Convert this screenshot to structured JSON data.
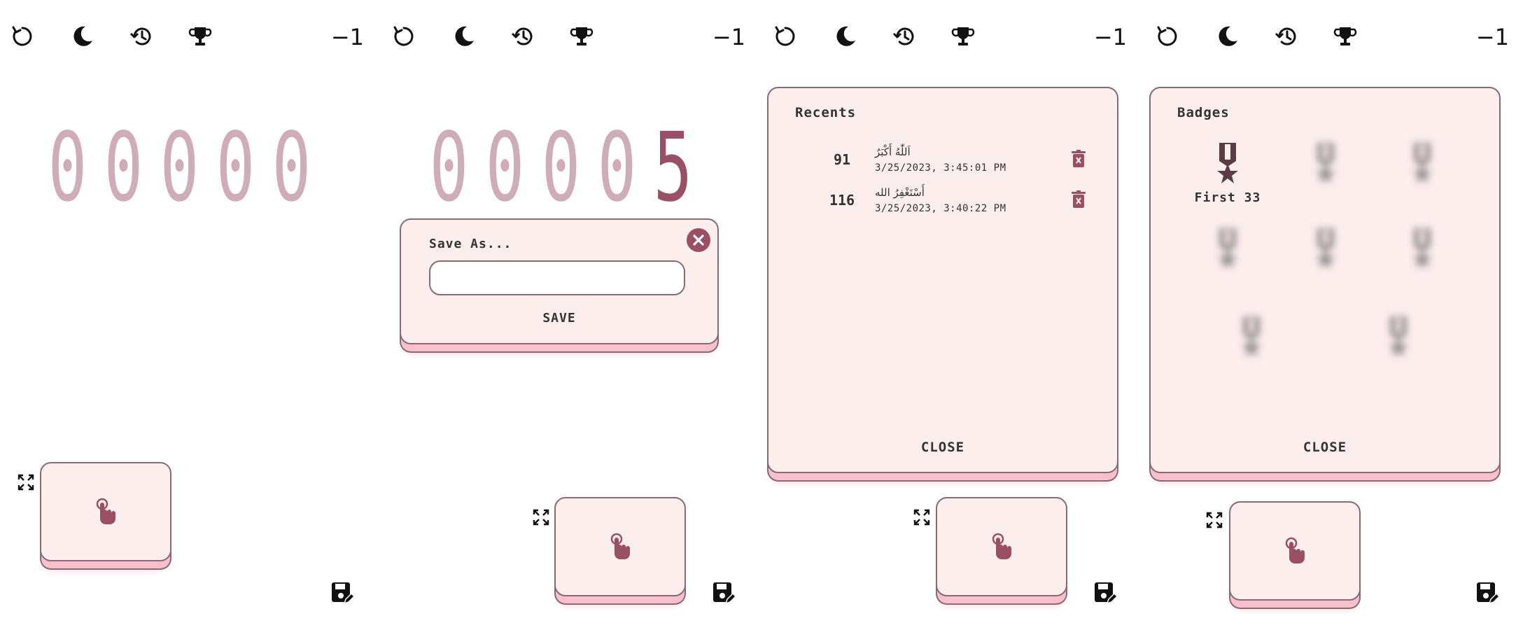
{
  "toolbar": {
    "step_value": "−1",
    "icons": [
      "reset-icon",
      "moon-icon",
      "history-icon",
      "trophy-icon"
    ]
  },
  "screen1": {
    "digits": [
      "0",
      "0",
      "0",
      "0",
      "0"
    ]
  },
  "screen2": {
    "digits": [
      "0",
      "0",
      "0",
      "0",
      "5"
    ],
    "dialog": {
      "title": "Save As...",
      "input_value": "",
      "save_label": "SAVE"
    }
  },
  "screen3": {
    "title": "Recents",
    "items": [
      {
        "count": "91",
        "text": "اَللّٰهُ أَكْبَرُ",
        "date": "3/25/2023, 3:45:01 PM"
      },
      {
        "count": "116",
        "text": "أَسْتَغْفِرُ الله",
        "date": "3/25/2023, 3:40:22 PM"
      }
    ],
    "close_label": "CLOSE"
  },
  "screen4": {
    "title": "Badges",
    "badges": [
      {
        "label": "First 33",
        "unlocked": true
      },
      {
        "label": "",
        "unlocked": false
      },
      {
        "label": "",
        "unlocked": false
      },
      {
        "label": "",
        "unlocked": false
      },
      {
        "label": "",
        "unlocked": false
      },
      {
        "label": "",
        "unlocked": false
      },
      {
        "label": "",
        "unlocked": false
      },
      {
        "label": "",
        "unlocked": false
      }
    ],
    "close_label": "CLOSE"
  },
  "colors": {
    "accent": "#9a5064",
    "digit_inactive": "#cfadb8",
    "card_bg": "#fdeeee",
    "card_shadow": "#f7c0cc",
    "border": "#8a6a72"
  }
}
